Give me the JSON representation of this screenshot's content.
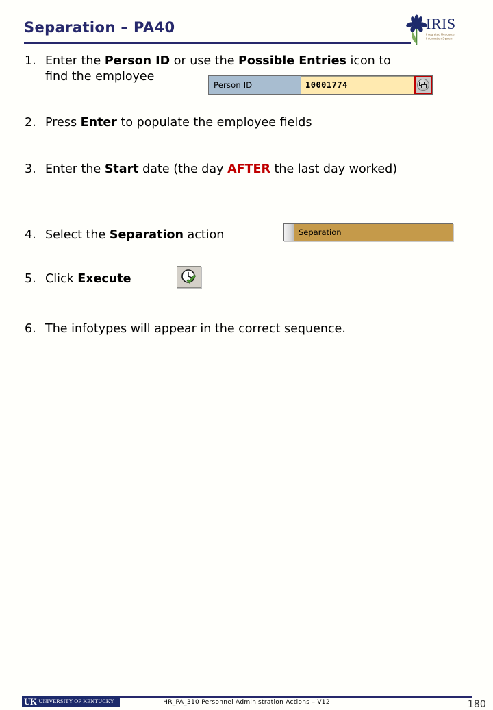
{
  "header": {
    "title": "Separation – PA40",
    "logo": {
      "name": "IRIS",
      "tagline_line1": "Integrated Resource",
      "tagline_line2": "Information System"
    }
  },
  "steps": [
    {
      "number": "1.",
      "parts": [
        {
          "text": "Enter the ",
          "style": "normal"
        },
        {
          "text": "Person ID",
          "style": "bold"
        },
        {
          "text": " or use the ",
          "style": "normal"
        },
        {
          "text": "Possible Entries",
          "style": "bold"
        },
        {
          "text": " icon to find the employee",
          "style": "normal"
        }
      ],
      "text_line1": "Enter the ",
      "text_bold1": "Person ID",
      "text_mid1": " or use the ",
      "text_bold2": "Possible Entries",
      "text_end": " icon to",
      "text_line2": "find the employee"
    },
    {
      "number": "2.",
      "text_pre": "Press ",
      "text_bold": "Enter",
      "text_post": " to populate the employee fields"
    },
    {
      "number": "3.",
      "text_pre": "Enter the ",
      "text_bold": "Start",
      "text_mid": " date (the day ",
      "text_red": "AFTER",
      "text_post": " the last day worked)"
    },
    {
      "number": "4.",
      "text_pre": "Select the ",
      "text_bold": "Separation",
      "text_post": " action"
    },
    {
      "number": "5.",
      "text_pre": "Click ",
      "text_bold": "Execute"
    },
    {
      "number": "6.",
      "text": "The infotypes will appear in the correct sequence."
    }
  ],
  "person_id_field": {
    "label": "Person ID",
    "value": "10001774",
    "placeholder": "",
    "icon": "possible-entries-icon",
    "highlight_color": "#c00000",
    "label_bg": "#a8bdd0",
    "input_bg": "#ffeab0"
  },
  "separation_field": {
    "value": "Separation",
    "bg": "#c59a4a"
  },
  "execute_button": {
    "icon": "clock-check-icon",
    "tooltip": "Execute"
  },
  "footer": {
    "uk_mark": "UK",
    "uk_wordmark": "UNIVERSITY OF KENTUCKY",
    "course_text": "HR_PA_310 Personnel Administration Actions – V12",
    "page_number": "180"
  },
  "colors": {
    "navy": "#26286b",
    "red": "#c00000",
    "background": "#fffffb"
  }
}
